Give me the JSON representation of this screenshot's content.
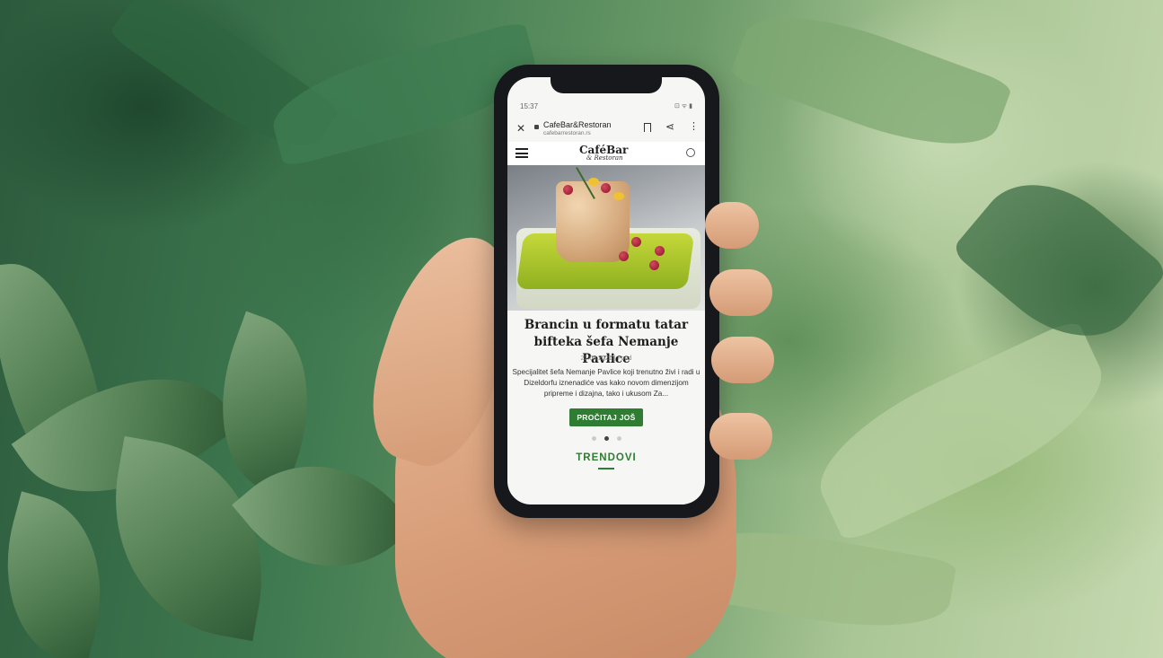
{
  "status_bar": {
    "time": "15:37",
    "icons": "⊡ ᯤ ▮"
  },
  "browser": {
    "close_icon": "close-icon",
    "site_title": "CafeBar&Restoran",
    "site_url": "cafebarrestoran.rs",
    "bookmark_icon": "bookmark-icon",
    "share_icon": "share-icon",
    "more_icon": "more-vertical-icon"
  },
  "site_header": {
    "menu_icon": "hamburger-icon",
    "logo_main": "CaféBar",
    "logo_sub": "& Restoran",
    "search_icon": "search-icon"
  },
  "article": {
    "title": "Brancin u formatu tatar bifteka šefa Nemanje Pavlice",
    "meta": "21.08.2021 | Food",
    "excerpt": "Specijalitet šefa Nemanje Pavlice koji trenutno živi i radi u Dizeldorfu iznenadiće vas kako novom dimenzijom pripreme i dizajna, tako i ukusom Za...",
    "read_more": "PROČITAJ JOŠ"
  },
  "carousel": {
    "count": 3,
    "active_index": 1
  },
  "section": {
    "title": "TRENDOVI"
  },
  "colors": {
    "accent": "#2e7d32",
    "phone_body": "#16181b"
  }
}
